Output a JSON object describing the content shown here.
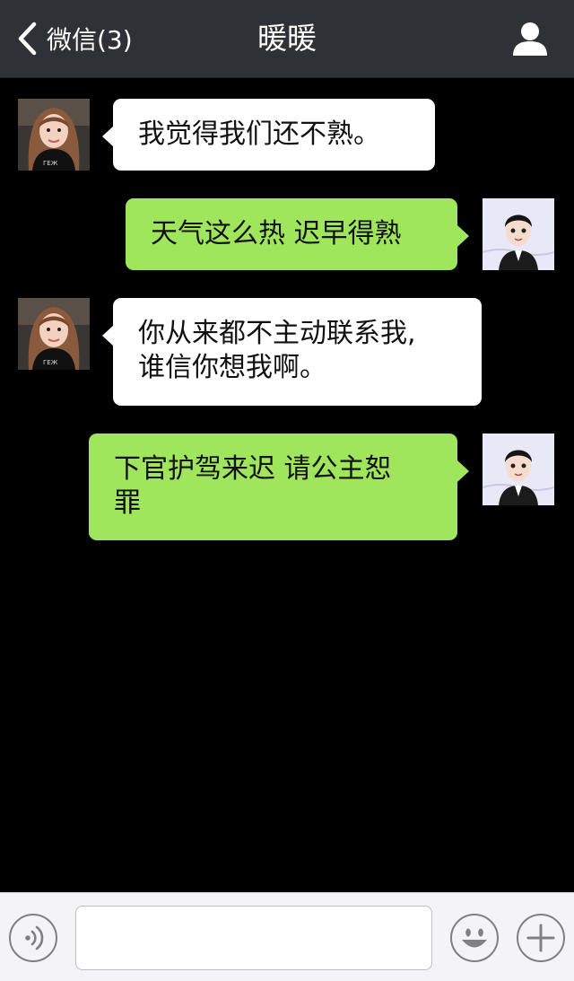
{
  "header": {
    "back_label": "微信(3)",
    "title": "暖暖"
  },
  "messages": [
    {
      "sender": "contact",
      "text": "我觉得我们还不熟。"
    },
    {
      "sender": "me",
      "text": "天气这么热 迟早得熟"
    },
    {
      "sender": "contact",
      "line1": "你从来都不主动联系我,",
      "line2": "谁信你想我啊。"
    },
    {
      "sender": "me",
      "line1": "下官护驾来迟 请公主恕",
      "line2": "罪"
    }
  ],
  "input": {
    "placeholder": "",
    "value": ""
  },
  "icons": {
    "back": "chevron-left-icon",
    "profile": "person-icon",
    "voice": "voice-icon",
    "emoji": "emoji-icon",
    "more": "plus-icon"
  },
  "colors": {
    "header_bg": "#2e3136",
    "chat_bg": "#000000",
    "incoming_bubble": "#ffffff",
    "outgoing_bubble": "#a0e65c",
    "input_bar_bg": "#f4f4f6"
  }
}
